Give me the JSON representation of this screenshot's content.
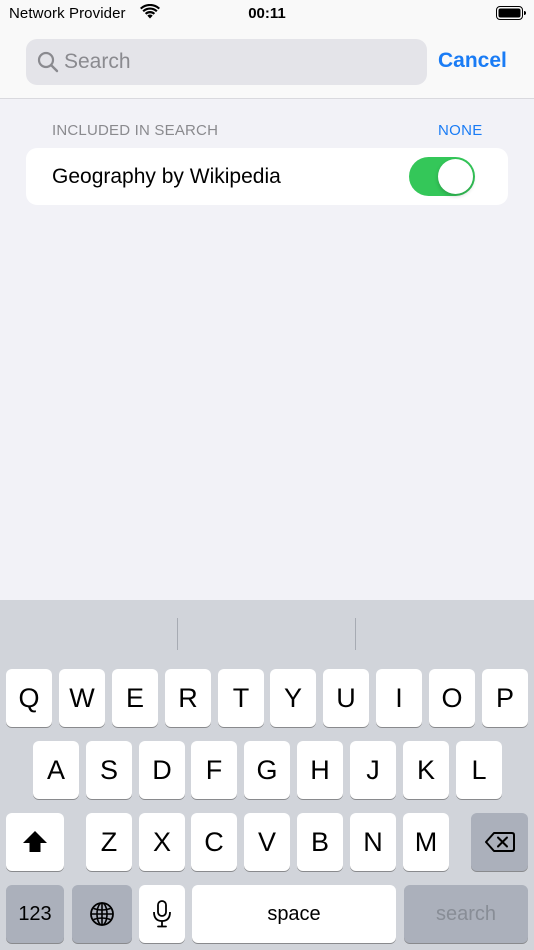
{
  "status_bar": {
    "carrier": "Network Provider",
    "time": "00:11",
    "wifi_icon": "wifi-icon",
    "battery_icon": "battery-icon"
  },
  "search": {
    "placeholder": "Search",
    "value": "",
    "cancel_label": "Cancel"
  },
  "section": {
    "header": "INCLUDED IN SEARCH",
    "none_label": "NONE",
    "items": [
      {
        "label": "Geography by Wikipedia",
        "enabled": true
      }
    ]
  },
  "keyboard": {
    "row1": [
      "Q",
      "W",
      "E",
      "R",
      "T",
      "Y",
      "U",
      "I",
      "O",
      "P"
    ],
    "row2": [
      "A",
      "S",
      "D",
      "F",
      "G",
      "H",
      "J",
      "K",
      "L"
    ],
    "row3": [
      "Z",
      "X",
      "C",
      "V",
      "B",
      "N",
      "M"
    ],
    "numbers_label": "123",
    "space_label": "space",
    "search_label": "search",
    "shift_icon": "shift-icon",
    "delete_icon": "delete-icon",
    "globe_icon": "globe-icon",
    "mic_icon": "microphone-icon"
  },
  "colors": {
    "accent": "#1a7cf5",
    "toggle_on": "#34c759",
    "background": "#f2f2f7",
    "keyboard_bg": "#d1d4da"
  }
}
